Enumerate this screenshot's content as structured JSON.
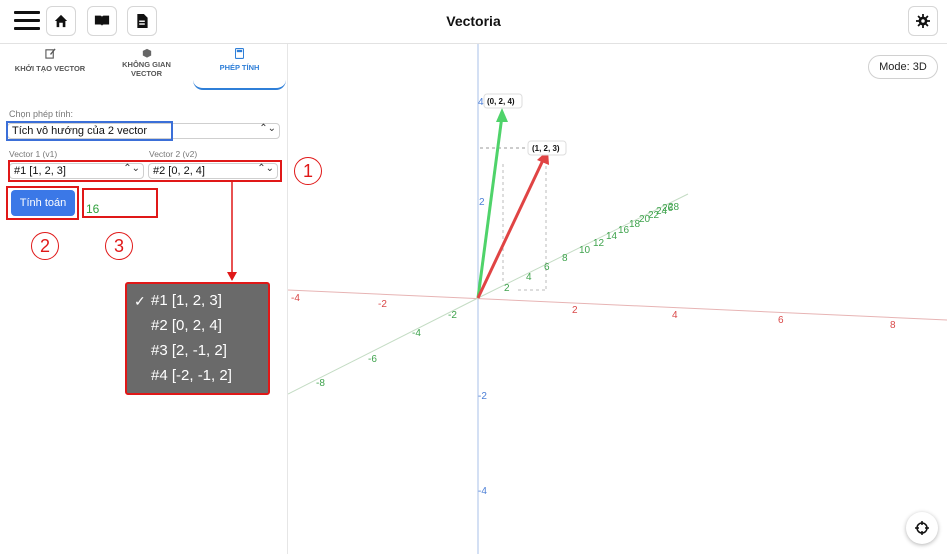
{
  "header": {
    "title": "Vectoria"
  },
  "tabs": [
    {
      "label1": "KHỞI TẠO VECTOR",
      "label2": ""
    },
    {
      "label1": "KHÔNG GIAN",
      "label2": "VECTOR"
    },
    {
      "label1": "PHÉP TÍNH",
      "label2": ""
    }
  ],
  "form": {
    "op_label": "Chọn phép tính:",
    "op_value": "Tích vô hướng của 2 vector",
    "v1_label": "Vector 1 (v1)",
    "v2_label": "Vector 2 (v2)",
    "v1_value": "#1 [1, 2, 3]",
    "v2_value": "#2 [0, 2, 4]",
    "calc_label": "Tính toán",
    "result": "16"
  },
  "dropdown": {
    "selected_mark": "✓",
    "options": [
      "#1 [1, 2, 3]",
      "#2 [0, 2, 4]",
      "#3 [2, -1, 2]",
      "#4 [-2, -1, 2]"
    ]
  },
  "annotations": [
    "1",
    "2",
    "3"
  ],
  "mode_label": "Mode: 3D",
  "viewport": {
    "vec1_label": "(1, 2, 3)",
    "vec2_label": "(0, 2, 4)",
    "x_ticks": [
      "-4",
      "-2",
      "2",
      "4",
      "6",
      "8"
    ],
    "y_ticks": [
      "2",
      "4",
      "6",
      "8",
      "10",
      "12",
      "14",
      "16",
      "18",
      "20",
      "22",
      "24",
      "26",
      "28"
    ],
    "z_ticks": [
      "4",
      "2",
      "-2",
      "-4"
    ],
    "neg_y_ticks": [
      "-2",
      "-4",
      "-6",
      "-8"
    ]
  },
  "colors": {
    "accent": "#2f7fd8",
    "button": "#3b78e7",
    "annotation": "#e01818",
    "x_axis": "#d94848",
    "y_axis": "#3fa34d",
    "z_axis": "#4c7fd6"
  }
}
